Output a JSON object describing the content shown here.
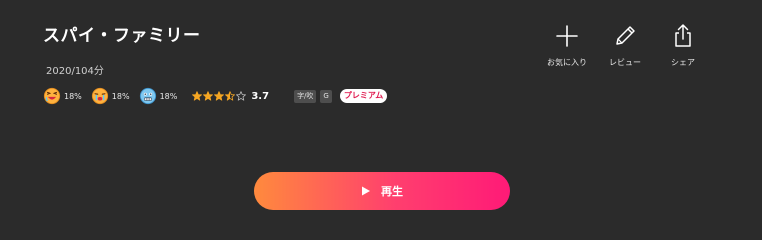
{
  "title": "スパイ・ファミリー",
  "meta": "2020/104分",
  "reactions": [
    {
      "icon": "laughing-face-icon",
      "percent": "18%"
    },
    {
      "icon": "crying-face-icon",
      "percent": "18%"
    },
    {
      "icon": "shocked-face-icon",
      "percent": "18%"
    }
  ],
  "rating": {
    "stars": 3.5,
    "max": 5,
    "score": "3.7"
  },
  "tags": [
    "字/吹",
    "G"
  ],
  "premium_label": "プレミアム",
  "actions": [
    {
      "icon": "plus-icon",
      "label": "お気に入り"
    },
    {
      "icon": "pencil-icon",
      "label": "レビュー"
    },
    {
      "icon": "share-icon",
      "label": "シェア"
    }
  ],
  "play_button": {
    "label": "再生",
    "icon": "play-icon"
  },
  "colors": {
    "background": "#2b2b2b",
    "gradient_start": "#ff8a3d",
    "gradient_end": "#ff1a77",
    "star": "#f5a623",
    "premium_text": "#e01a4f"
  }
}
